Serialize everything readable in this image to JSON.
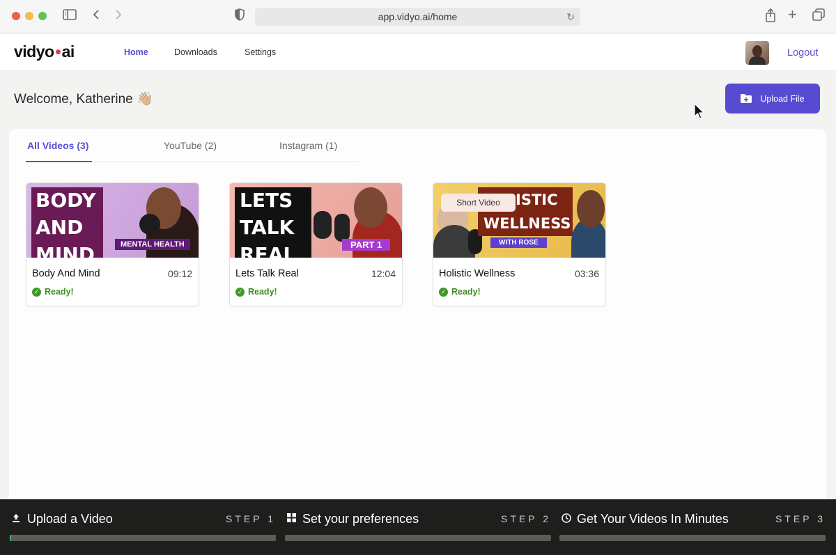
{
  "browser": {
    "url": "app.vidyo.ai/home"
  },
  "header": {
    "logo_left": "vidyo",
    "logo_right": "ai",
    "nav": [
      {
        "label": "Home",
        "active": true
      },
      {
        "label": "Downloads",
        "active": false
      },
      {
        "label": "Settings",
        "active": false
      }
    ],
    "logout_label": "Logout"
  },
  "welcome": {
    "text": "Welcome, Katherine 👋🏼"
  },
  "upload": {
    "label": "Upload File"
  },
  "tabs": [
    {
      "label": "All Videos (3)",
      "active": true
    },
    {
      "label": "YouTube (2)",
      "active": false
    },
    {
      "label": "Instagram (1)",
      "active": false
    }
  ],
  "videos": [
    {
      "title": "Body And Mind",
      "duration": "09:12",
      "status": "Ready!",
      "thumb_lines": [
        "BODY",
        "AND",
        "MIND"
      ],
      "thumb_tag": "MENTAL HEALTH"
    },
    {
      "title": "Lets Talk Real",
      "duration": "12:04",
      "status": "Ready!",
      "thumb_lines": [
        "LETS",
        "TALK",
        "REAL"
      ],
      "thumb_tag": "PART 1"
    },
    {
      "title": "Holistic Wellness",
      "duration": "03:36",
      "status": "Ready!",
      "badge": "Short Video",
      "thumb_lines": [
        "ISTIC",
        "WELLNESS"
      ],
      "thumb_tag": "WITH ROSE"
    }
  ],
  "steps": [
    {
      "label": "Upload a Video",
      "step": "STEP 1",
      "icon": "upload-icon",
      "progress": 0.005
    },
    {
      "label": "Set your preferences",
      "step": "STEP 2",
      "icon": "grid-icon",
      "progress": 0
    },
    {
      "label": "Get Your Videos In Minutes",
      "step": "STEP 3",
      "icon": "clock-icon",
      "progress": 0
    }
  ],
  "colors": {
    "accent": "#574bd2",
    "ready": "#3f8f22",
    "footer": "#1e1f1c"
  }
}
